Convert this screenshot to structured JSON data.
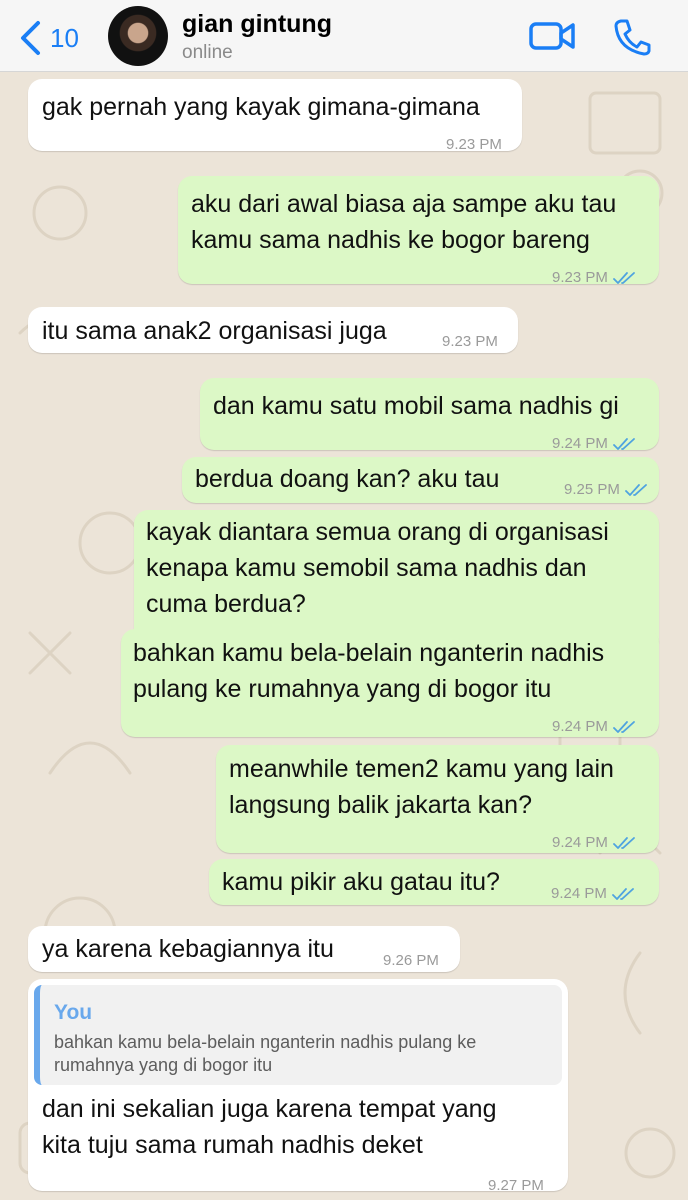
{
  "header": {
    "back_count": "10",
    "contact_name": "gian gintung",
    "contact_status": "online"
  },
  "messages": [
    {
      "dir": "in",
      "lines": [
        "gak pernah yang kayak gimana-gimana"
      ],
      "time": "9.23 PM"
    },
    {
      "dir": "out",
      "lines": [
        "aku dari awal biasa aja sampe aku tau",
        "kamu sama nadhis ke bogor bareng"
      ],
      "time": "9.23 PM",
      "read": true
    },
    {
      "dir": "in",
      "lines": [
        "itu sama anak2 organisasi juga"
      ],
      "time": "9.23 PM"
    },
    {
      "dir": "out",
      "lines": [
        "dan kamu satu mobil sama nadhis gi"
      ],
      "time": "9.24 PM",
      "read": true
    },
    {
      "dir": "out",
      "lines": [
        "berdua doang kan? aku tau"
      ],
      "time": "9.25 PM",
      "read": true
    },
    {
      "dir": "out",
      "lines": [
        "kayak diantara semua orang di organisasi",
        "kenapa kamu semobil sama nadhis dan",
        "cuma berdua?"
      ],
      "time": "9.24 PM",
      "read": true
    },
    {
      "dir": "out",
      "lines": [
        "bahkan kamu bela-belain nganterin nadhis",
        "pulang ke rumahnya yang di bogor itu"
      ],
      "time": "9.24 PM",
      "read": true
    },
    {
      "dir": "out",
      "lines": [
        "meanwhile temen2 kamu yang lain",
        "langsung balik jakarta kan?"
      ],
      "time": "9.24 PM",
      "read": true
    },
    {
      "dir": "out",
      "lines": [
        "kamu pikir aku gatau itu?"
      ],
      "time": "9.24 PM",
      "read": true
    },
    {
      "dir": "in",
      "lines": [
        "ya karena kebagiannya itu"
      ],
      "time": "9.26 PM"
    },
    {
      "dir": "in",
      "quote": {
        "author": "You",
        "lines": [
          "bahkan kamu bela-belain nganterin nadhis pulang ke",
          "rumahnya yang di bogor itu"
        ]
      },
      "lines": [
        "dan ini sekalian juga karena tempat yang",
        "kita tuju sama rumah nadhis deket"
      ],
      "time": "9.27 PM"
    }
  ],
  "colors": {
    "accent": "#1a7ef5",
    "outgoing_bubble": "#dcf8c6",
    "incoming_bubble": "#ffffff",
    "read_check": "#4fa3e0",
    "quote_bar": "#69a8ec",
    "chat_background": "#ece4d8"
  },
  "icons": [
    "chevron-left-icon",
    "video-call-icon",
    "phone-call-icon",
    "double-check-icon"
  ]
}
